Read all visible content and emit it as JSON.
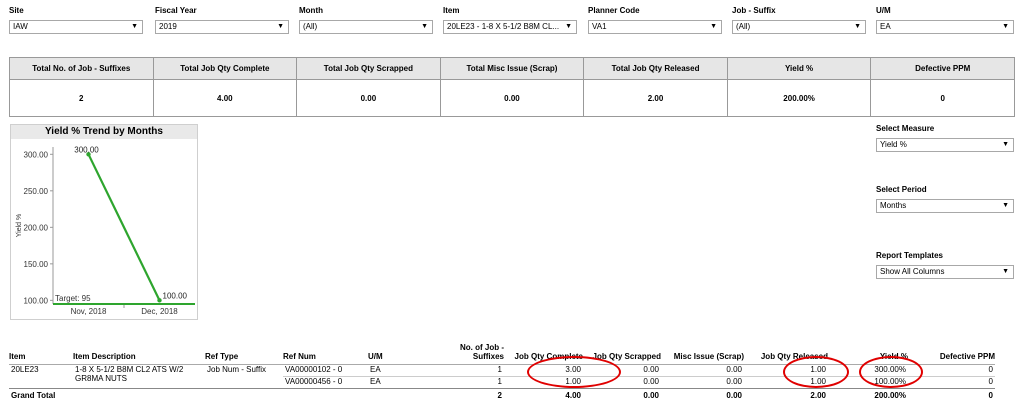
{
  "filters": [
    {
      "label": "Site",
      "value": "IAW"
    },
    {
      "label": "Fiscal Year",
      "value": "2019"
    },
    {
      "label": "Month",
      "value": "(All)"
    },
    {
      "label": "Item",
      "value": "20LE23 - 1-8 X 5-1/2 B8M CL..."
    },
    {
      "label": "Planner Code",
      "value": "VA1"
    },
    {
      "label": "Job - Suffix",
      "value": "(All)"
    },
    {
      "label": "U/M",
      "value": "EA"
    }
  ],
  "kpis": {
    "headers": [
      "Total No. of Job - Suffixes",
      "Total Job Qty Complete",
      "Total Job Qty Scrapped",
      "Total Misc Issue (Scrap)",
      "Total Job Qty Released",
      "Yield %",
      "Defective PPM"
    ],
    "values": [
      "2",
      "4.00",
      "0.00",
      "0.00",
      "2.00",
      "200.00%",
      "0"
    ]
  },
  "chart_data": {
    "type": "line",
    "title": "Yield % Trend by Months",
    "ylabel": "Yield %",
    "categories": [
      "Nov, 2018",
      "Dec, 2018"
    ],
    "values": [
      300.0,
      100.0
    ],
    "data_labels": [
      "300.00",
      "100.00"
    ],
    "yticks": [
      "300.00",
      "250.00",
      "200.00",
      "150.00",
      "100.00"
    ],
    "ylim": [
      95,
      310
    ],
    "target": {
      "label": "Target: 95",
      "value": 95
    },
    "line_color": "#2ea52e",
    "target_color": "#2ea52e"
  },
  "side": {
    "measure_label": "Select Measure",
    "measure_value": "Yield %",
    "period_label": "Select Period",
    "period_value": "Months",
    "templates_label": "Report Templates",
    "templates_value": "Show All Columns"
  },
  "grid": {
    "headers": [
      "Item",
      "Item Description",
      "Ref Type",
      "Ref Num",
      "U/M",
      "No. of Job - Suffixes",
      "Job Qty Complete",
      "Job Qty Scrapped",
      "Misc Issue (Scrap)",
      "Job Qty Released",
      "Yield %",
      "Defective PPM"
    ],
    "item": "20LE23",
    "description": "1-8 X 5-1/2 B8M CL2 ATS W/2 GR8MA NUTS",
    "ref_type": "Job Num - Suffix",
    "rows": [
      {
        "ref_num": "VA00000102 - 0",
        "um": "EA",
        "jobs": "1",
        "complete": "3.00",
        "scrapped": "0.00",
        "misc": "0.00",
        "released": "1.00",
        "yield": "300.00%",
        "ppm": "0"
      },
      {
        "ref_num": "VA00000456 - 0",
        "um": "EA",
        "jobs": "1",
        "complete": "1.00",
        "scrapped": "0.00",
        "misc": "0.00",
        "released": "1.00",
        "yield": "100.00%",
        "ppm": "0"
      }
    ],
    "total": {
      "label": "Grand Total",
      "jobs": "2",
      "complete": "4.00",
      "scrapped": "0.00",
      "misc": "0.00",
      "released": "2.00",
      "yield": "200.00%",
      "ppm": "0"
    }
  }
}
